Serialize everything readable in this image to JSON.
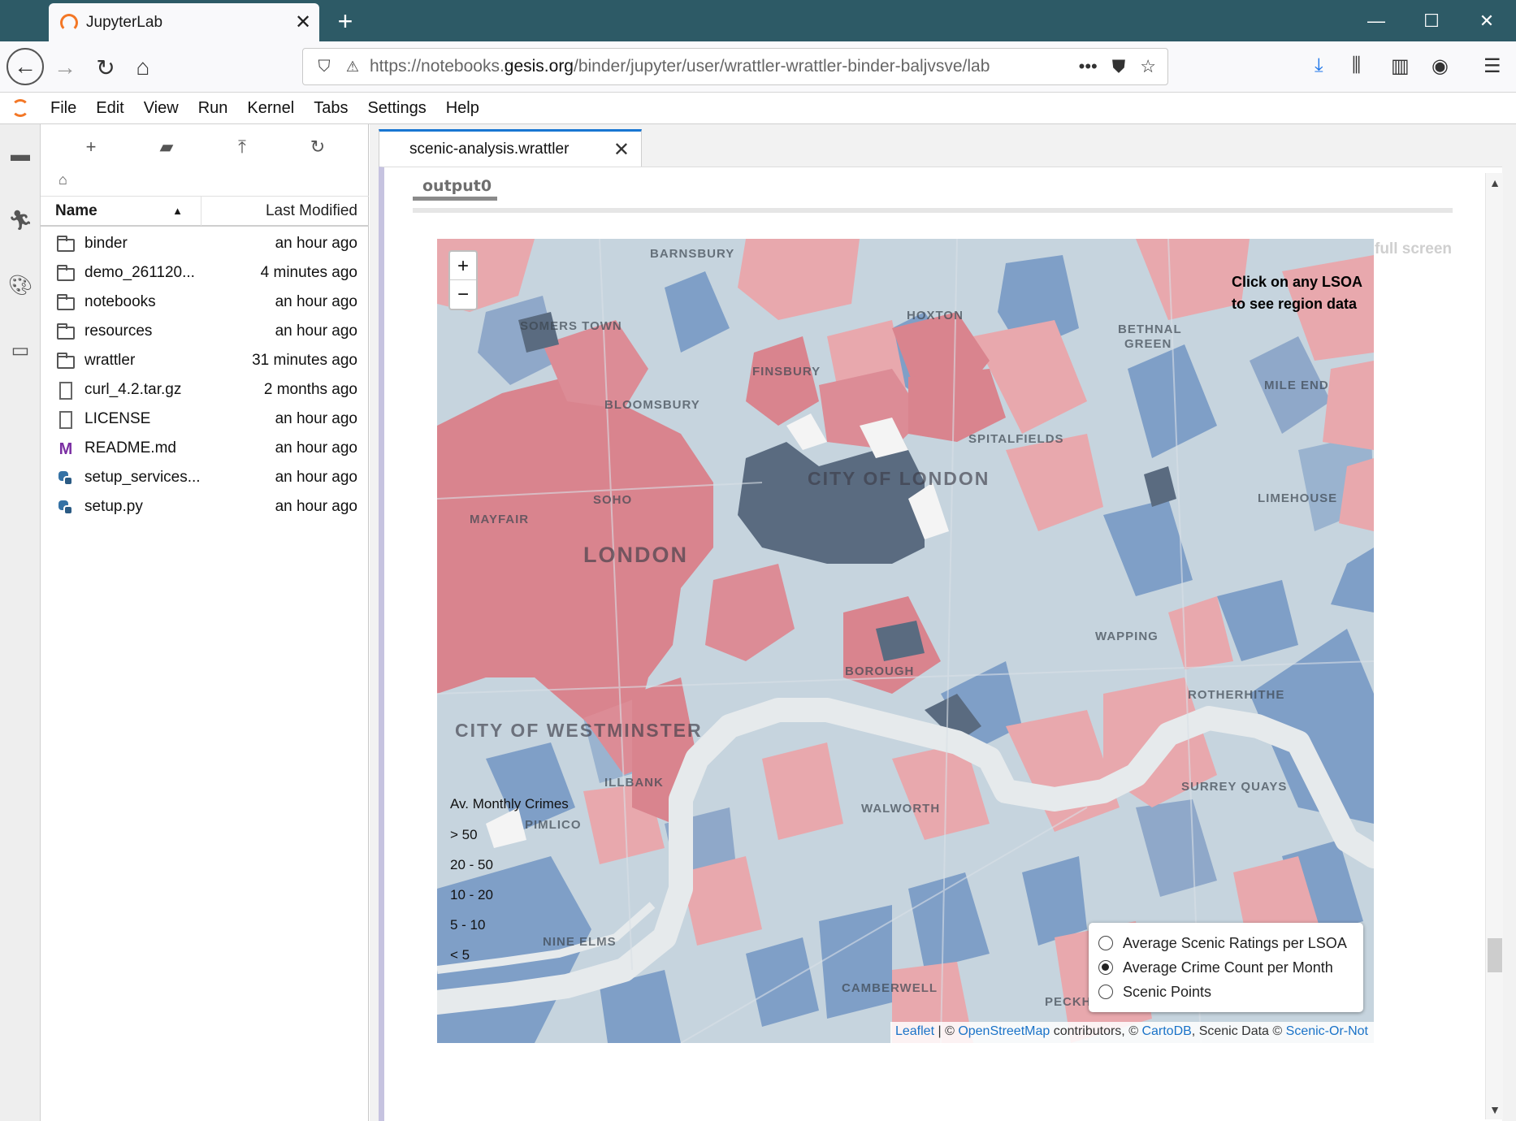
{
  "browser": {
    "tab_title": "JupyterLab",
    "url_prefix": "https://notebooks.",
    "url_domain": "gesis.org",
    "url_suffix": "/binder/jupyter/user/wrattler-wrattler-binder-baljvsve/lab"
  },
  "menu": [
    "File",
    "Edit",
    "View",
    "Run",
    "Kernel",
    "Tabs",
    "Settings",
    "Help"
  ],
  "filebrowser": {
    "col_name": "Name",
    "col_modified": "Last Modified",
    "files": [
      {
        "name": "binder",
        "modified": "an hour ago",
        "type": "folder"
      },
      {
        "name": "demo_261120...",
        "modified": "4 minutes ago",
        "type": "folder"
      },
      {
        "name": "notebooks",
        "modified": "an hour ago",
        "type": "folder"
      },
      {
        "name": "resources",
        "modified": "an hour ago",
        "type": "folder"
      },
      {
        "name": "wrattler",
        "modified": "31 minutes ago",
        "type": "folder"
      },
      {
        "name": "curl_4.2.tar.gz",
        "modified": "2 months ago",
        "type": "file"
      },
      {
        "name": "LICENSE",
        "modified": "an hour ago",
        "type": "file"
      },
      {
        "name": "README.md",
        "modified": "an hour ago",
        "type": "markdown"
      },
      {
        "name": "setup_services...",
        "modified": "an hour ago",
        "type": "python"
      },
      {
        "name": "setup.py",
        "modified": "an hour ago",
        "type": "python"
      }
    ]
  },
  "document": {
    "tab_label": "scenic-analysis.wrattler",
    "output_label": "output0",
    "full_screen": "full screen"
  },
  "map": {
    "zoom_in": "+",
    "zoom_out": "−",
    "info_line1": "Click on any LSOA",
    "info_line2": "to see region data",
    "labels": {
      "barnsbury": "BARNSBURY",
      "somers_town": "SOMERS TOWN",
      "hoxton": "HOXTON",
      "bethnal_green_1": "BETHNAL",
      "bethnal_green_2": "GREEN",
      "finsbury": "FINSBURY",
      "mile_end": "MILE END",
      "bloomsbury": "BLOOMSBURY",
      "spitalfields": "SPITALFIELDS",
      "city_of_london": "CITY OF LONDON",
      "soho": "SOHO",
      "mayfair": "MAYFAIR",
      "limehouse": "LIMEHOUSE",
      "london": "LONDON",
      "wapping": "WAPPING",
      "borough": "BOROUGH",
      "rotherhithe": "ROTHERHITHE",
      "westminster": "CITY OF WESTMINSTER",
      "millbank": "ILLBANK",
      "surrey_quays": "SURREY QUAYS",
      "walworth": "WALWORTH",
      "pimlico": "PIMLICO",
      "nine_elms": "NINE ELMS",
      "camberwell": "CAMBERWELL",
      "peckham": "PECKHAM"
    },
    "legend": {
      "title": "Av. Monthly Crimes",
      "items": [
        "> 50",
        "20 - 50",
        "10 - 20",
        "5 - 10",
        "< 5"
      ]
    },
    "layers": [
      {
        "label": "Average Scenic Ratings per LSOA",
        "selected": false
      },
      {
        "label": "Average Crime Count per Month",
        "selected": true
      },
      {
        "label": "Scenic Points",
        "selected": false
      }
    ],
    "attribution": {
      "leaflet": "Leaflet",
      "sep1": " | © ",
      "osm": "OpenStreetMap",
      "mid": " contributors, © ",
      "carto": "CartoDB",
      "scenic_text": ", Scenic Data © ",
      "scenic_link": "Scenic-Or-Not"
    },
    "colors": {
      "light_blue": "#c3d3de",
      "mid_blue": "#7f9fc7",
      "dark_blue": "#5b7aa8",
      "pink": "#e8a8ad",
      "red": "#d97e88",
      "slate": "#5a6b80",
      "river": "#e4e8ea"
    }
  }
}
